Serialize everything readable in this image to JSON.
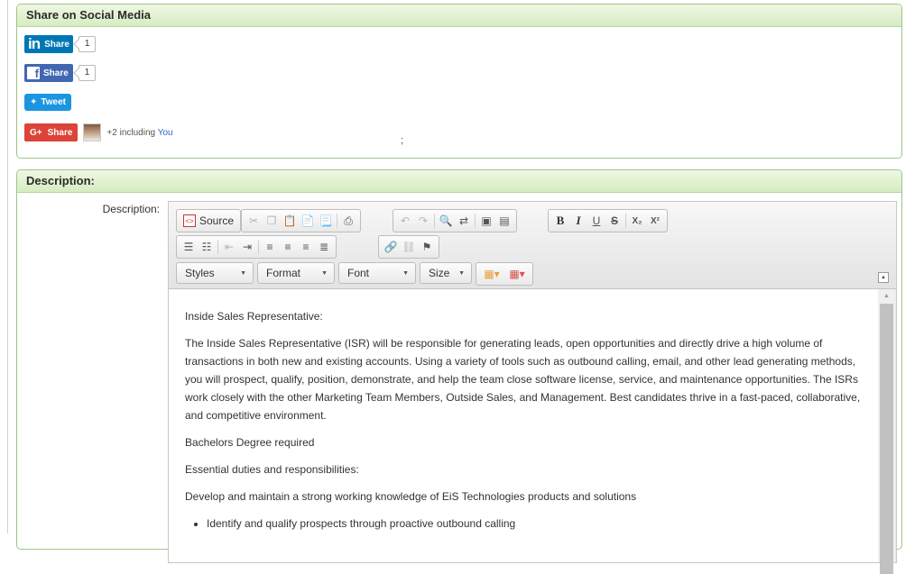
{
  "social": {
    "title": "Share on Social Media",
    "linkedin": {
      "logo": "in",
      "label": "Share",
      "count": "1"
    },
    "facebook": {
      "logo": "f",
      "label": "Share",
      "count": "1"
    },
    "twitter": {
      "logo": "✦",
      "label": "Tweet"
    },
    "google": {
      "logo": "G+",
      "label": "Share",
      "text": "+2 including",
      "you": "You"
    },
    "semicolon": ";"
  },
  "description": {
    "title": "Description:",
    "label": "Description:",
    "toolbar": {
      "source_label": "Source",
      "styles": "Styles",
      "format": "Format",
      "font": "Font",
      "size": "Size",
      "bold": "B",
      "italic": "I",
      "underline": "U",
      "strike": "S",
      "subscript": "X₂",
      "superscript": "X²"
    },
    "content": {
      "heading": "Inside Sales Representative:",
      "para1": "The Inside Sales Representative (ISR) will be responsible for generating leads, open opportunities and directly drive a high volume of transactions in both new and existing accounts. Using a variety of tools such as outbound calling, email, and other lead generating methods, you will prospect, qualify, position, demonstrate, and help the team close software license, service, and maintenance opportunities.  The ISRs work closely with the other Marketing Team Members, Outside Sales, and Management.  Best candidates thrive in a fast-paced, collaborative, and competitive environment.",
      "para2": "Bachelors Degree required",
      "para3": "Essential duties and responsibilities:",
      "para4": "Develop and maintain a strong working knowledge of EiS Technologies products and solutions",
      "bullet1": "Identify and qualify prospects through proactive outbound calling"
    }
  }
}
